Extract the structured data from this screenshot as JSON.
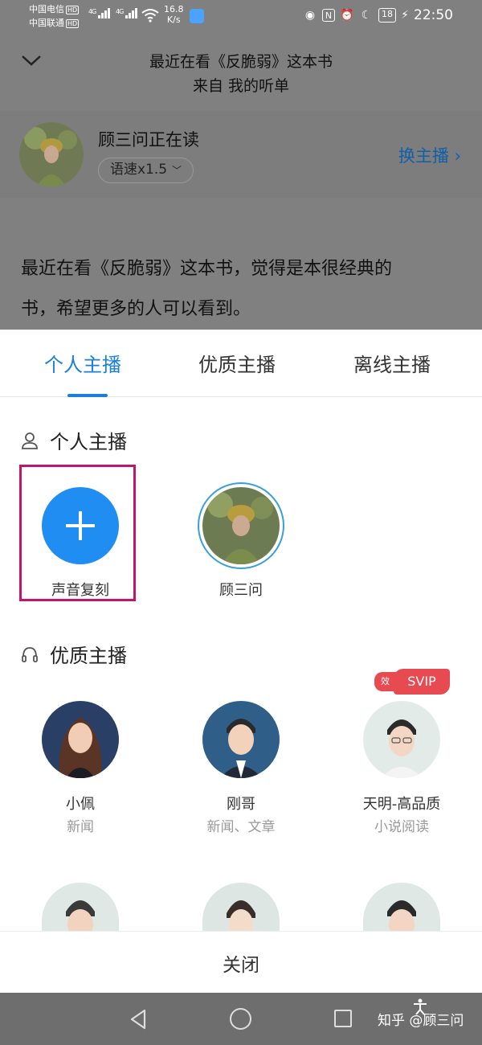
{
  "status_bar": {
    "carrier1": "中国电信",
    "carrier2": "中国联通",
    "hd": "HD",
    "net1": "4G",
    "net2": "4G",
    "speed_value": "16.8",
    "speed_unit": "K/s",
    "battery": "18",
    "time": "22:50"
  },
  "header": {
    "title_line1": "最近在看《反脆弱》这本书",
    "title_line2": "来自 我的听单"
  },
  "reader": {
    "name": "顾三问正在读",
    "speed": "语速x1.5",
    "switch": "换主播"
  },
  "content": {
    "line1": "最近在看《反脆弱》这本书，觉得是本很经典的",
    "line2": "书，希望更多的人可以看到。"
  },
  "tabs": [
    {
      "label": "个人主播"
    },
    {
      "label": "优质主播"
    },
    {
      "label": "离线主播"
    }
  ],
  "personal_section": {
    "title": "个人主播",
    "items": [
      {
        "label": "声音复刻"
      },
      {
        "label": "顾三问"
      }
    ]
  },
  "premium_section": {
    "title": "优质主播",
    "anchors": [
      {
        "name": "小佩",
        "category": "新闻"
      },
      {
        "name": "刚哥",
        "category": "新闻、文章"
      },
      {
        "name": "天明-高品质",
        "category": "小说阅读",
        "badge": "SVIP",
        "badge_prefix": "效"
      }
    ]
  },
  "close": "关闭",
  "watermark": "知乎 @顾三问",
  "colors": {
    "accent": "#1a7fd8",
    "highlight": "#c0176d",
    "svip": "#e84a52"
  }
}
